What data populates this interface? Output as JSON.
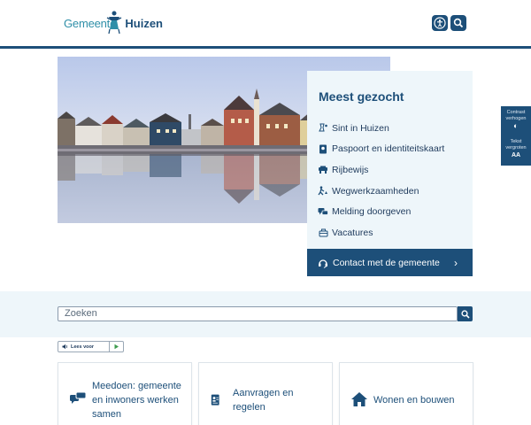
{
  "header": {
    "logo_part1": "Gemeente",
    "logo_part2": "Huizen",
    "accessibility_icon": "accessibility-icon",
    "search_icon": "search-icon"
  },
  "hero": {
    "image_alt": "harbour-with-houses-photo"
  },
  "meest_gezocht": {
    "title": "Meest gezocht",
    "items": [
      {
        "label": "Sint in Huizen",
        "icon": "sint-icon"
      },
      {
        "label": "Paspoort en identiteitskaart",
        "icon": "passport-icon"
      },
      {
        "label": "Rijbewijs",
        "icon": "car-icon"
      },
      {
        "label": "Wegwerkzaamheden",
        "icon": "roadworks-icon"
      },
      {
        "label": "Melding doorgeven",
        "icon": "chat-icon"
      },
      {
        "label": "Vacatures",
        "icon": "briefcase-icon"
      }
    ],
    "contact_label": "Contact met de gemeente",
    "contact_chevron": "›"
  },
  "side_widget": {
    "contrast_label_1": "Contrast",
    "contrast_label_2": "verhogen",
    "contrast_icon": "◐",
    "text_label_1": "Tekst",
    "text_label_2": "vergroten",
    "text_icon": "AA"
  },
  "search": {
    "placeholder": "Zoeken"
  },
  "lees_voor": {
    "label": "Lees voor"
  },
  "cards": [
    {
      "line1": "Meedoen: gemeente",
      "line2": "en inwoners werken",
      "line3": "samen",
      "icon": "speech-bubbles-icon"
    },
    {
      "line1": "Aanvragen en",
      "line2": "regelen",
      "icon": "id-form-icon"
    },
    {
      "line1": "Wonen en bouwen",
      "icon": "house-icon"
    }
  ],
  "colors": {
    "primary": "#1d4f79",
    "accent": "#2f8fa8",
    "band": "#eef6fa"
  }
}
